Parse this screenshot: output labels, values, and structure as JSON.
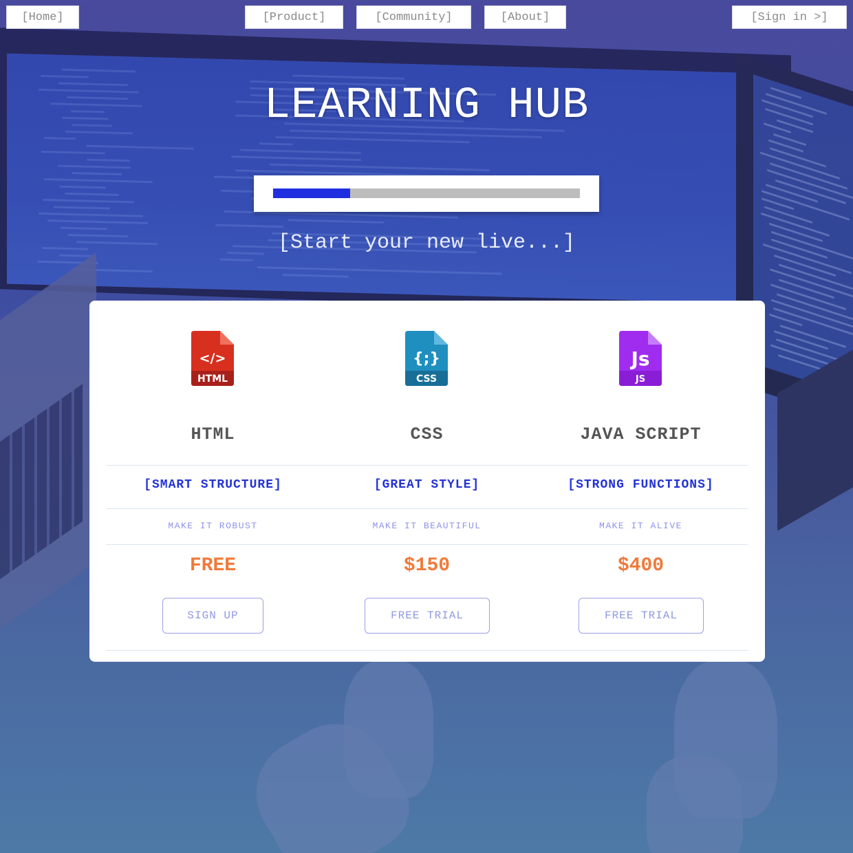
{
  "nav": {
    "home": "[Home]",
    "product": "[Product]",
    "community": "[Community]",
    "about": "[About]",
    "signin": "[Sign in >]"
  },
  "hero": {
    "title": "LEARNING HUB",
    "progress_fraction": 0.25,
    "tagline": "[Start your new live...]"
  },
  "colors": {
    "progress_fill": "#1f2fe0",
    "feature_text": "#2433d6",
    "price_text": "#f07a3a",
    "html_icon": "#d8301f",
    "css_icon": "#1f8fc0",
    "js_icon": "#a02cf0"
  },
  "plans": [
    {
      "icon": "html-file-icon",
      "icon_text": "</>",
      "icon_label": "HTML",
      "name": "HTML",
      "feature": "[SMART STRUCTURE]",
      "subtext": "MAKE IT ROBUST",
      "price": "FREE",
      "cta": "SIGN UP"
    },
    {
      "icon": "css-file-icon",
      "icon_text": "{;}",
      "icon_label": "CSS",
      "name": "CSS",
      "feature": "[GREAT STYLE]",
      "subtext": "MAKE IT BEAUTIFUL",
      "price": "$150",
      "cta": "FREE TRIAL"
    },
    {
      "icon": "js-file-icon",
      "icon_text": "Js",
      "icon_label": "JS",
      "name": "JAVA SCRIPT",
      "feature": "[STRONG FUNCTIONS]",
      "subtext": "MAKE IT ALIVE",
      "price": "$400",
      "cta": "FREE TRIAL"
    }
  ]
}
